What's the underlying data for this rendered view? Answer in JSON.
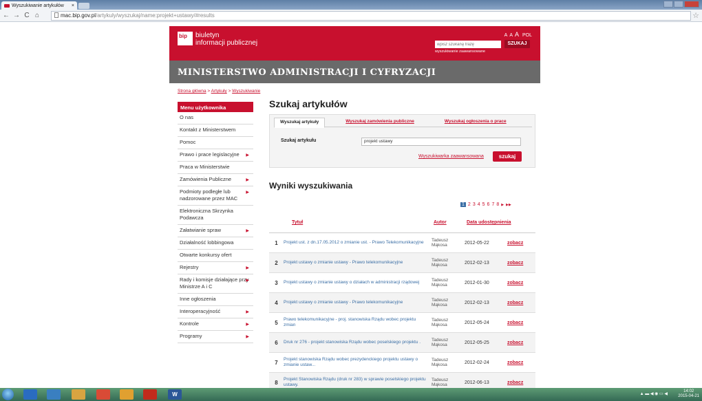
{
  "browser": {
    "tab_title": "Wyszukiwanie artykułów",
    "tab_close": "×",
    "url_host": "mac.bip.gov.pl",
    "url_path": "/artykuly/wyszukaj/name:projekt+ustawy/#results",
    "back": "←",
    "forward": "→",
    "reload": "C",
    "home": "⌂",
    "star": "☆"
  },
  "header": {
    "logo_badge": "bip",
    "logo_line1": "biuletyn",
    "logo_line2": "informacji publicznej",
    "font_small": "A",
    "font_medium": "A",
    "font_large": "A",
    "language": "POL",
    "search_placeholder": "wpisz szukaną frazę",
    "search_button": "SZUKAJ",
    "advanced_search": "wyszukiwanie zaawansowane",
    "ministry": "MINISTERSTWO ADMINISTRACJI I CYFRYZACJI"
  },
  "breadcrumb": {
    "items": [
      "Strona główna",
      "Artykuły",
      "Wyszukiwanie"
    ],
    "separator": ">"
  },
  "sidebar": {
    "heading": "Menu użytkownika",
    "items": [
      {
        "label": "O nas",
        "arrow": ""
      },
      {
        "label": "Kontakt z Ministerstwem",
        "arrow": ""
      },
      {
        "label": "Pomoc",
        "arrow": ""
      },
      {
        "label": "Prawo i prace legislacyjne",
        "arrow": "▶"
      },
      {
        "label": "Praca w Ministerstwie",
        "arrow": ""
      },
      {
        "label": "Zamówienia Publiczne",
        "arrow": "▶"
      },
      {
        "label": "Podmioty podległe lub nadzorowane przez MAC",
        "arrow": "▶"
      },
      {
        "label": "Elektroniczna Skrzynka Podawcza",
        "arrow": ""
      },
      {
        "label": "Załatwianie spraw",
        "arrow": "▶"
      },
      {
        "label": "Działalność lobbingowa",
        "arrow": ""
      },
      {
        "label": "Otwarte konkursy ofert",
        "arrow": ""
      },
      {
        "label": "Rejestry",
        "arrow": "▶"
      },
      {
        "label": "Rady i komisje działające przy Ministrze A i C",
        "arrow": "▶"
      },
      {
        "label": "Inne ogłoszenia",
        "arrow": ""
      },
      {
        "label": "Interoperacyjność",
        "arrow": "▶"
      },
      {
        "label": "Kontrole",
        "arrow": "▶"
      },
      {
        "label": "Programy",
        "arrow": "▶"
      }
    ]
  },
  "main": {
    "title": "Szukaj artykułów",
    "tabs": [
      "Wyszukaj artykuły",
      "Wyszukaj zamówienia publiczne",
      "Wyszukaj ogłoszenia o prace"
    ],
    "search_label": "Szukaj artykułu",
    "search_value": "projekt ustawy",
    "advanced_link": "Wyszukiwarka zaawansowana",
    "submit": "szukaj",
    "results_title": "Wyniki wyszukiwania",
    "pagination": {
      "pages": [
        "1",
        "2",
        "3",
        "4",
        "5",
        "6",
        "7",
        "8"
      ],
      "current": "1",
      "next": "▶",
      "last": "▶▶"
    },
    "columns": {
      "title": "Tytuł",
      "author": "Autor",
      "date": "Data udostępnienia"
    },
    "view_label": "zobacz",
    "results": [
      {
        "num": "1",
        "title": "Projekt ust. z dn.17.05.2012 o zmianie ust. - Prawo Telekomunikacyjne",
        "author": "Tadeusz Mąkosa",
        "date": "2012-05-22"
      },
      {
        "num": "2",
        "title": "Projekt ustawy o zmianie ustawy - Prawo telekomunikacyjne",
        "author": "Tadeusz Mąkosa",
        "date": "2012-02-13"
      },
      {
        "num": "3",
        "title": "Projekt ustawy o zmianie ustawy o działach w administracji rządowej",
        "author": "Tadeusz Mąkosa",
        "date": "2012-01-30"
      },
      {
        "num": "4",
        "title": "Projekt ustawy o zmianie ustawy - Prawo telekomunikacyjne",
        "author": "Tadeusz Mąkosa",
        "date": "2012-02-13"
      },
      {
        "num": "5",
        "title": "Prawo telekomunikacyjne - proj. stanowiska Rządu wobec projektu zmian",
        "author": "Tadeusz Mąkosa",
        "date": "2012-05-24"
      },
      {
        "num": "6",
        "title": "Druk nr 276 - projekt stanowiska Rządu wobec poselskiego projektu .",
        "author": "Tadeusz Mąkosa",
        "date": "2012-05-25"
      },
      {
        "num": "7",
        "title": "Projekt stanowiska Rządu wobec prezydenckiego projektu ustawy o zmianie ustaw...",
        "author": "Tadeusz Mąkosa",
        "date": "2012-02-24"
      },
      {
        "num": "8",
        "title": "Projekt Stanowiska Rządu (druk nr 283) w sprawie poselskiego projektu ustawy.",
        "author": "Tadeusz Mąkosa",
        "date": "2012-06-13"
      }
    ]
  },
  "taskbar": {
    "word_label": "W",
    "clock_time": "14:02",
    "clock_date": "2015-04-21"
  }
}
